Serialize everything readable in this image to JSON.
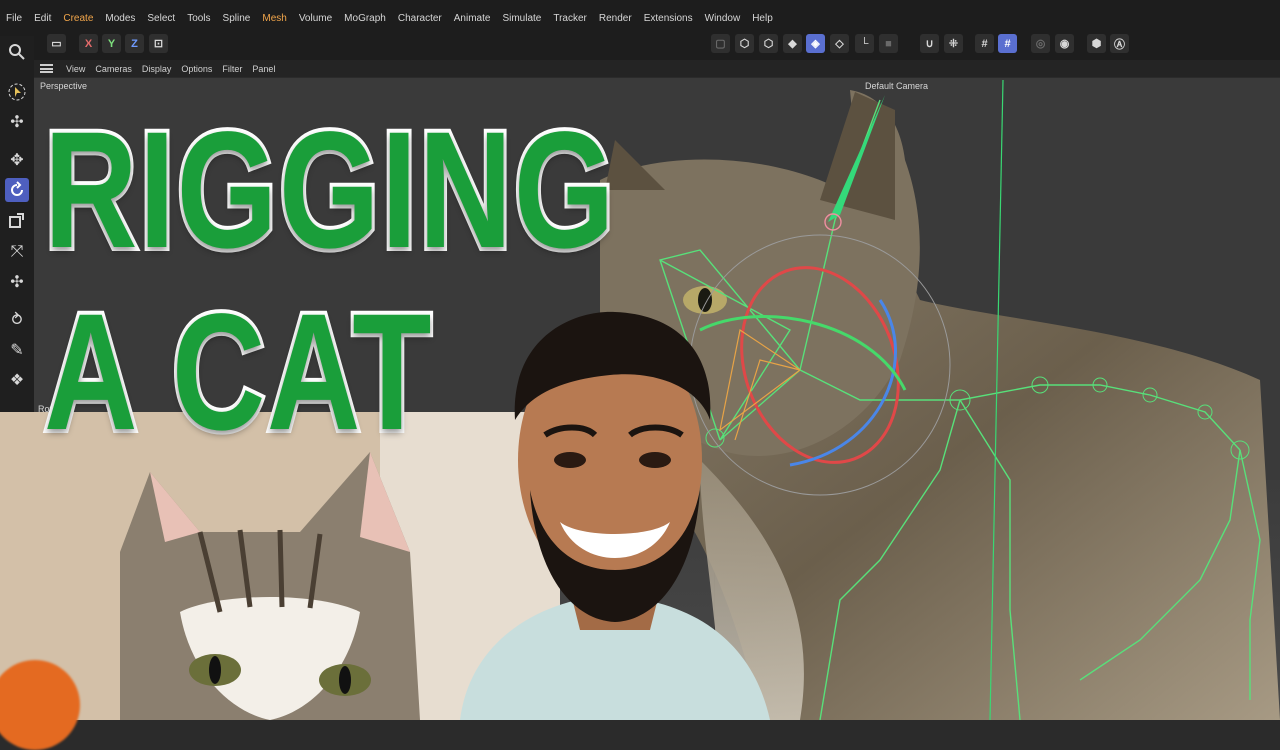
{
  "menu": {
    "items": [
      "File",
      "Edit",
      "Create",
      "Modes",
      "Select",
      "Tools",
      "Spline",
      "Mesh",
      "Volume",
      "MoGraph",
      "Character",
      "Animate",
      "Simulate",
      "Tracker",
      "Render",
      "Extensions",
      "Window",
      "Help"
    ],
    "accent_items": [
      "Create",
      "Mesh"
    ]
  },
  "toolbar": {
    "axis_x": "X",
    "axis_y": "Y",
    "axis_z": "Z"
  },
  "view_menu": {
    "items": [
      "View",
      "Cameras",
      "Display",
      "Options",
      "Filter",
      "Panel"
    ]
  },
  "viewport": {
    "label": "Perspective",
    "camera_label": "Default Camera",
    "bottom_label": "Rota"
  },
  "thumbnail": {
    "title_line1": "RIGGING",
    "title_line2": "A CAT"
  },
  "colors": {
    "title_fill": "#1a9e3a",
    "title_stroke": "#ffffff",
    "accent_menu": "#f2a64b",
    "active_tool": "#4e5fbf",
    "rig_green": "#58e07a"
  },
  "icons": {
    "search": "search-icon",
    "move": "move-icon",
    "rotate": "rotate-icon",
    "scale": "scale-icon"
  }
}
